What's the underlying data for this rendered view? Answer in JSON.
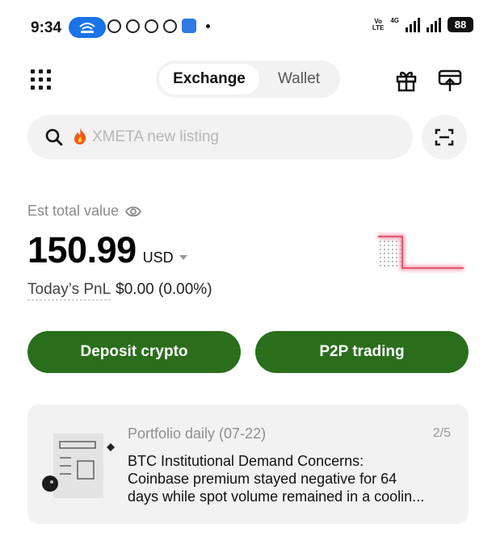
{
  "status_bar": {
    "time": "9:34",
    "network_top": "4G",
    "volte_line1": "Vo",
    "volte_line2": "LTE",
    "battery": "88"
  },
  "header": {
    "tabs": [
      {
        "label": "Exchange",
        "active": true
      },
      {
        "label": "Wallet",
        "active": false
      }
    ],
    "icons": [
      "apps-grid-icon",
      "gift-icon",
      "transfer-icon"
    ]
  },
  "search": {
    "placeholder": "XMETA new listing",
    "prefix_icon": "fire-icon"
  },
  "balance": {
    "label": "Est total value",
    "value": "150.99",
    "currency": "USD",
    "pnl_label": "Today’s PnL",
    "pnl_value": "$0.00 (0.00%)",
    "sparkline_color": "#e05a74"
  },
  "actions": {
    "deposit_label": "Deposit crypto",
    "p2p_label": "P2P trading",
    "color": "#2a6e1c"
  },
  "card": {
    "title": "Portfolio daily (07-22)",
    "pager": "2/5",
    "lines": [
      "BTC Institutional Demand Concerns:",
      "Coinbase premium stayed negative for 64",
      "days while spot volume remained in a coolin..."
    ]
  }
}
